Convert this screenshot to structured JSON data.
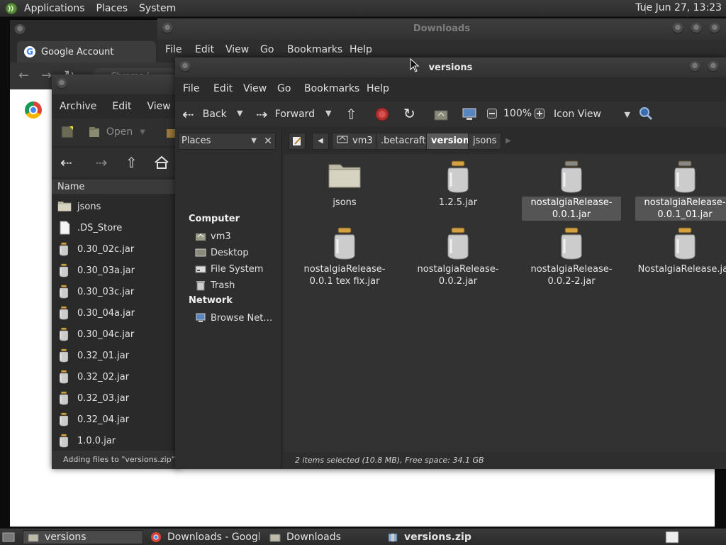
{
  "top_panel": {
    "menus": [
      "Applications",
      "Places",
      "System"
    ],
    "clock": "Tue Jun 27, 13:23"
  },
  "chrome": {
    "tab_title": "Google Account",
    "omnibox_fragment": "Chrome |"
  },
  "downloads_window": {
    "title": "Downloads",
    "menus": [
      "File",
      "Edit",
      "View",
      "Go",
      "Bookmarks",
      "Help"
    ]
  },
  "archive_window": {
    "menus": [
      "Archive",
      "Edit",
      "View",
      "H"
    ],
    "open_label": "Open",
    "column_name": "Name",
    "files": [
      {
        "name": "jsons",
        "type": "folder"
      },
      {
        "name": ".DS_Store",
        "type": "file"
      },
      {
        "name": "0.30_02c.jar",
        "type": "jar"
      },
      {
        "name": "0.30_03a.jar",
        "type": "jar"
      },
      {
        "name": "0.30_03c.jar",
        "type": "jar"
      },
      {
        "name": "0.30_04a.jar",
        "type": "jar"
      },
      {
        "name": "0.30_04c.jar",
        "type": "jar"
      },
      {
        "name": "0.32_01.jar",
        "type": "jar"
      },
      {
        "name": "0.32_02.jar",
        "type": "jar"
      },
      {
        "name": "0.32_03.jar",
        "type": "jar"
      },
      {
        "name": "0.32_04.jar",
        "type": "jar"
      },
      {
        "name": "1.0.0.jar",
        "type": "jar"
      }
    ],
    "status": "Adding files to \"versions.zip\""
  },
  "versions_window": {
    "title": "versions",
    "menus": [
      "File",
      "Edit",
      "View",
      "Go",
      "Bookmarks",
      "Help"
    ],
    "toolbar": {
      "back": "Back",
      "forward": "Forward",
      "zoom": "100%",
      "view_mode": "Icon View"
    },
    "sidebar": {
      "combo": "Places",
      "computer_heading": "Computer",
      "computer_items": [
        {
          "label": "vm3",
          "icon": "home-icon"
        },
        {
          "label": "Desktop",
          "icon": "desktop-icon"
        },
        {
          "label": "File System",
          "icon": "drive-icon"
        },
        {
          "label": "Trash",
          "icon": "trash-icon"
        }
      ],
      "network_heading": "Network",
      "network_items": [
        {
          "label": "Browse Net…",
          "icon": "network-icon"
        }
      ]
    },
    "breadcrumbs": [
      "vm3",
      ".betacraft",
      "versions",
      "jsons"
    ],
    "active_crumb": "versions",
    "items": [
      {
        "label": "jsons",
        "type": "folder",
        "selected": false
      },
      {
        "label": "1.2.5.jar",
        "type": "jar",
        "selected": false
      },
      {
        "label": "nostalgiaRelease-0.0.1.jar",
        "type": "jar",
        "selected": true
      },
      {
        "label": "nostalgiaRelease-0.0.1_01.jar",
        "type": "jar",
        "selected": true
      },
      {
        "label": "nostalgiaRelease-0.0.1 tex fix.jar",
        "type": "jar",
        "selected": false
      },
      {
        "label": "nostalgiaRelease-0.0.2.jar",
        "type": "jar",
        "selected": false
      },
      {
        "label": "nostalgiaRelease-0.0.2-2.jar",
        "type": "jar",
        "selected": false
      },
      {
        "label": "NostalgiaRelease.jar",
        "type": "jar",
        "selected": false
      }
    ],
    "status": "2 items selected (10.8 MB), Free space: 34.1 GB"
  },
  "taskbar": {
    "tasks": [
      {
        "label": "versions",
        "icon": "folder-icon",
        "active": true
      },
      {
        "label": "Downloads - Googl…",
        "icon": "chrome-icon",
        "active": false
      },
      {
        "label": "Downloads",
        "icon": "folder-icon",
        "active": false
      },
      {
        "label": "versions.zip",
        "icon": "archive-icon",
        "active": false
      }
    ]
  }
}
